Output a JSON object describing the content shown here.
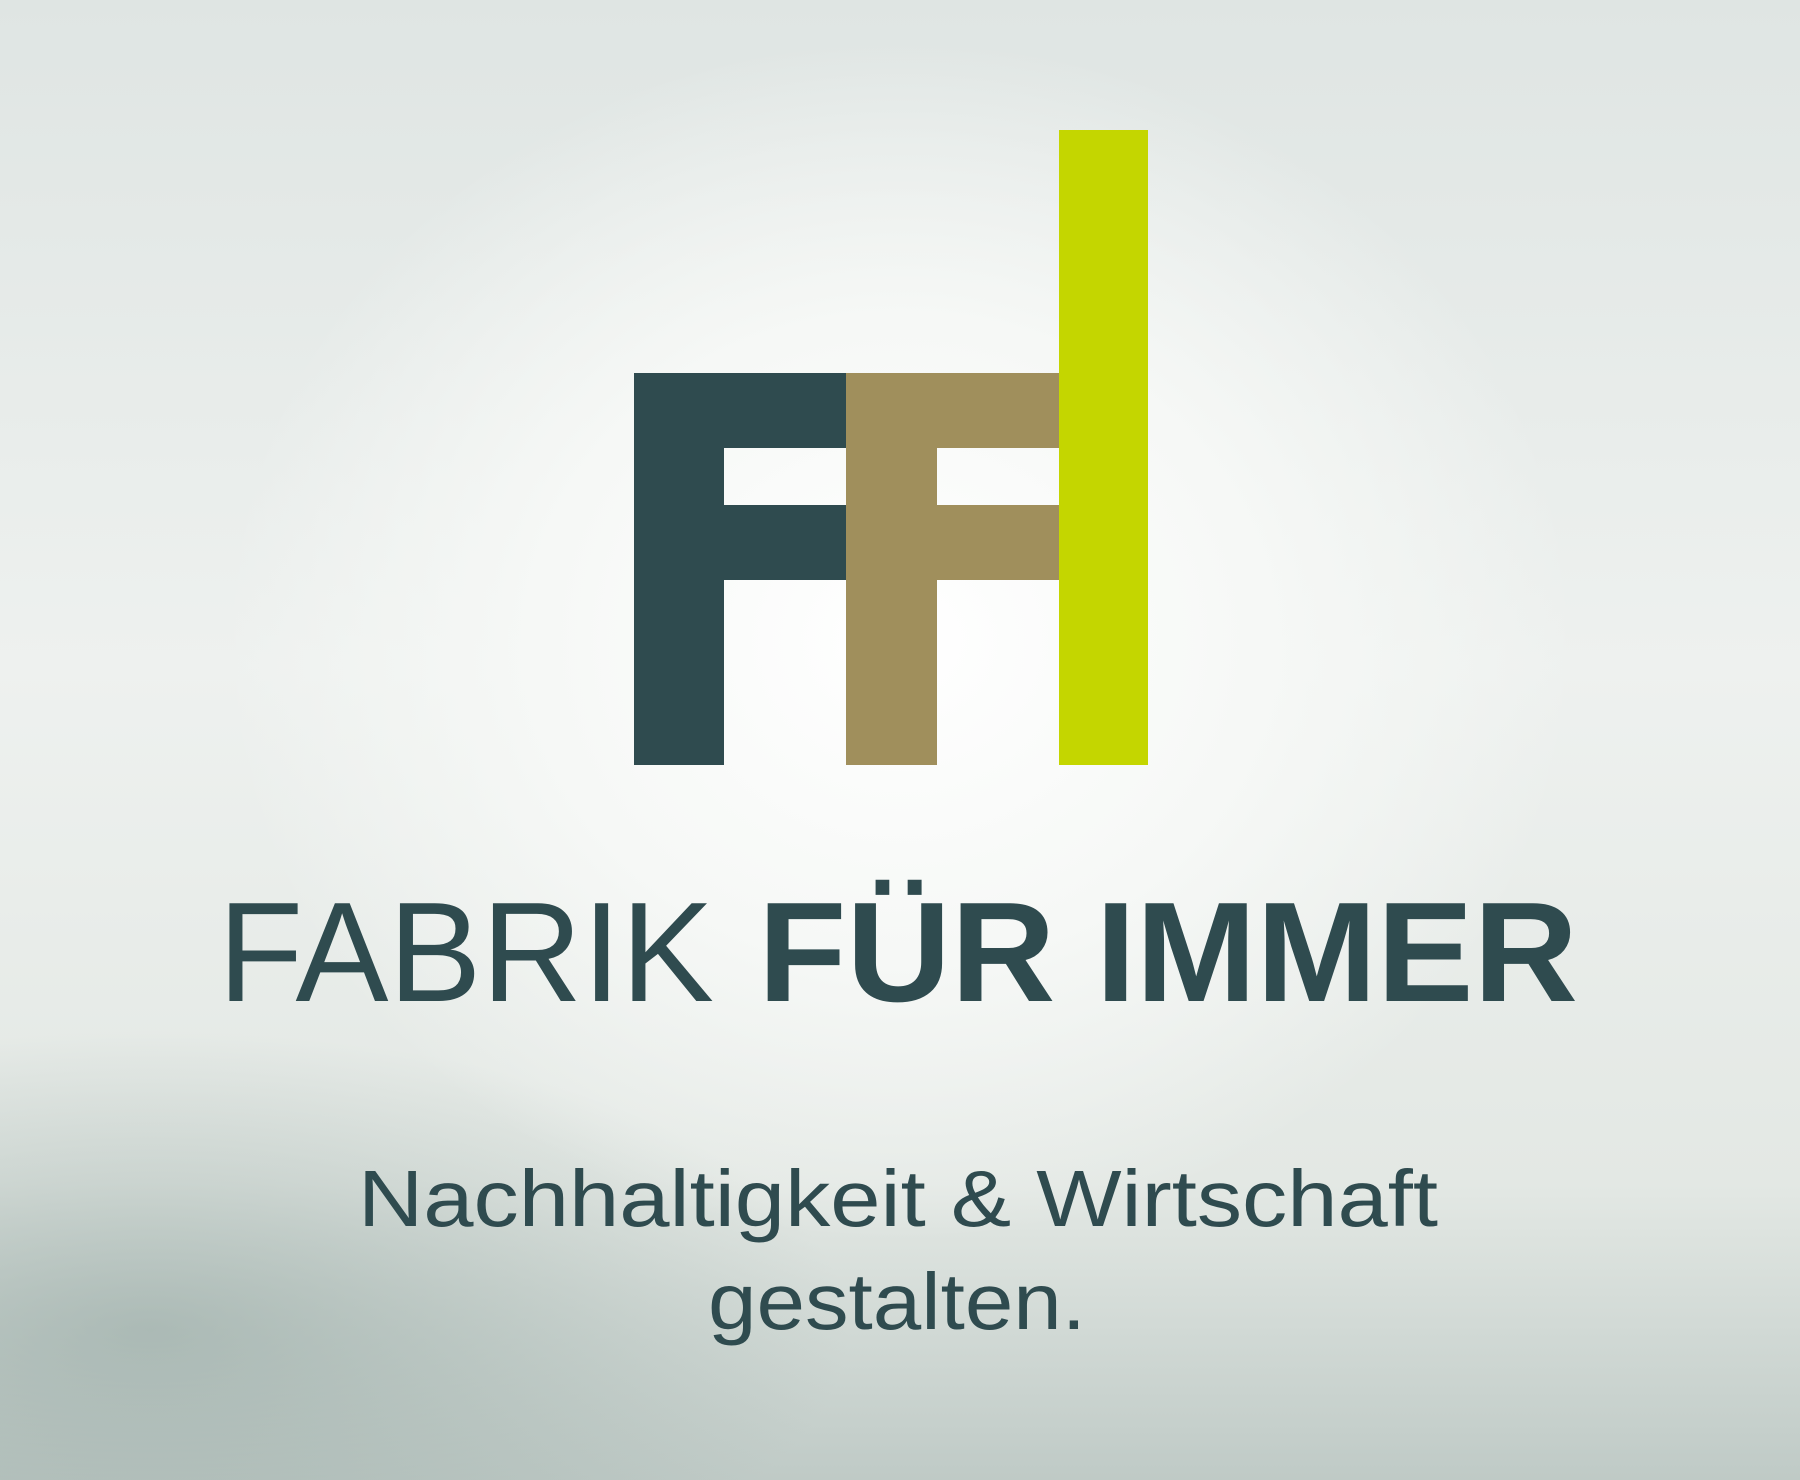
{
  "logo": {
    "colors": {
      "dark": "#2f4b4f",
      "olive": "#a08f5c",
      "lime": "#c4d600"
    }
  },
  "brand": {
    "light_word": "FABRIK",
    "bold_words": "FÜR IMMER"
  },
  "tagline": {
    "line1": "Nachhaltigkeit & Wirtschaft",
    "line2": "gestalten."
  },
  "text_color": "#2f4b4f"
}
